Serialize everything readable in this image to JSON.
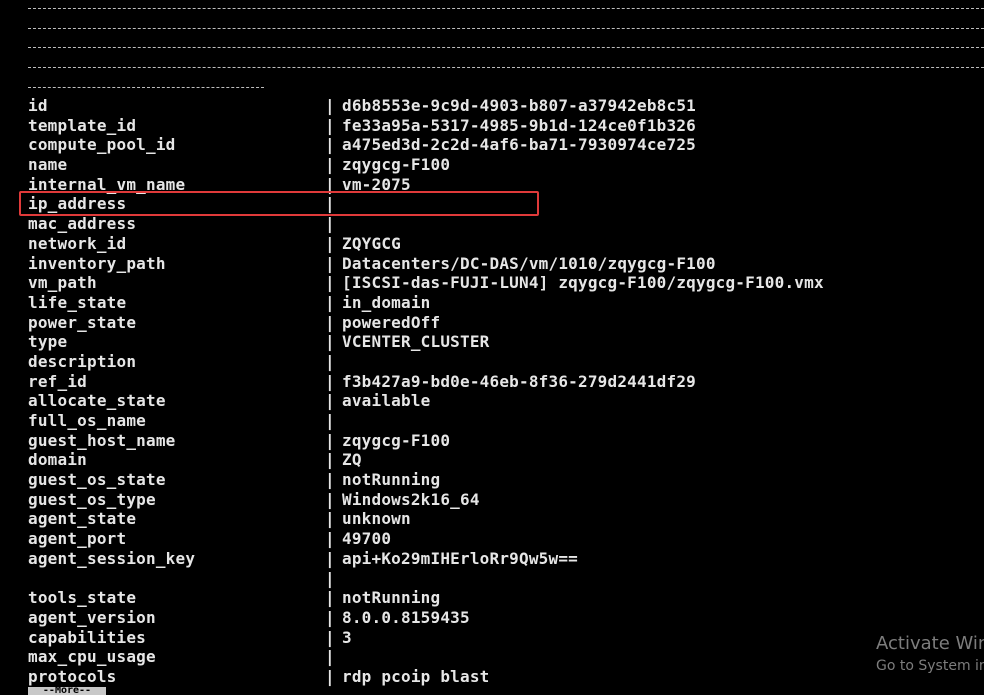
{
  "rows": [
    {
      "key": "id",
      "value": "d6b8553e-9c9d-4903-b807-a37942eb8c51"
    },
    {
      "key": "template_id",
      "value": "fe33a95a-5317-4985-9b1d-124ce0f1b326"
    },
    {
      "key": "compute_pool_id",
      "value": "a475ed3d-2c2d-4af6-ba71-7930974ce725"
    },
    {
      "key": "name",
      "value": "zqygcg-F100"
    },
    {
      "key": "internal_vm_name",
      "value": "vm-2075"
    },
    {
      "key": "ip_address",
      "value": ""
    },
    {
      "key": "mac_address",
      "value": ""
    },
    {
      "key": "network_id",
      "value": "ZQYGCG"
    },
    {
      "key": "inventory_path",
      "value": "Datacenters/DC-DAS/vm/1010/zqygcg-F100"
    },
    {
      "key": "vm_path",
      "value": "[ISCSI-das-FUJI-LUN4] zqygcg-F100/zqygcg-F100.vmx"
    },
    {
      "key": "life_state",
      "value": "in_domain"
    },
    {
      "key": "power_state",
      "value": "poweredOff"
    },
    {
      "key": "type",
      "value": "VCENTER_CLUSTER"
    },
    {
      "key": "description",
      "value": ""
    },
    {
      "key": "ref_id",
      "value": "f3b427a9-bd0e-46eb-8f36-279d2441df29"
    },
    {
      "key": "allocate_state",
      "value": "available"
    },
    {
      "key": "full_os_name",
      "value": ""
    },
    {
      "key": "guest_host_name",
      "value": "zqygcg-F100"
    },
    {
      "key": "domain",
      "value": "ZQ"
    },
    {
      "key": "guest_os_state",
      "value": "notRunning"
    },
    {
      "key": "guest_os_type",
      "value": "Windows2k16_64"
    },
    {
      "key": "agent_state",
      "value": "unknown"
    },
    {
      "key": "agent_port",
      "value": "49700"
    },
    {
      "key": "agent_session_key",
      "value": "api+Ko29mIHErloRr9Qw5w=="
    },
    {
      "key": "",
      "value": ""
    },
    {
      "key": "tools_state",
      "value": "notRunning"
    },
    {
      "key": "agent_version",
      "value": "8.0.0.8159435"
    },
    {
      "key": "capabilities",
      "value": "3"
    },
    {
      "key": "max_cpu_usage",
      "value": ""
    },
    {
      "key": "protocols",
      "value": "rdp pcoip blast"
    }
  ],
  "separator": "|",
  "more_label": "--More--",
  "watermark": {
    "title": "Activate Windows",
    "subtitle": "Go to System in Control Panel to activate Windows."
  },
  "colors": {
    "background": "#000000",
    "text": "#e6e6e6",
    "highlight_border": "#e03a3a"
  }
}
